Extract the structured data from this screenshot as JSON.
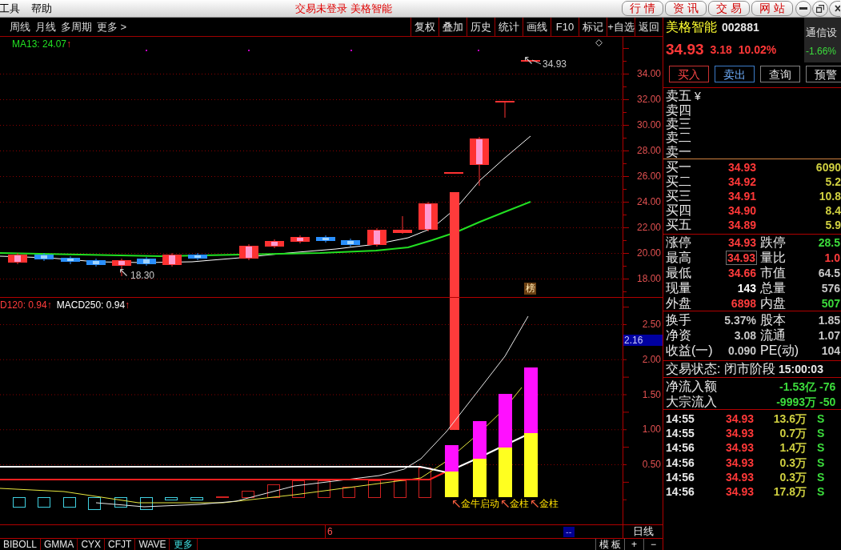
{
  "menu_bar": {
    "menus": [
      "工具",
      "帮助"
    ],
    "status": "交易未登录 美格智能",
    "nav_buttons": [
      "行 情",
      "资 讯",
      "交 易",
      "网 站"
    ]
  },
  "period_bar": {
    "items": [
      "周线",
      "月线",
      "多周期",
      "更多 >"
    ]
  },
  "toolbar": {
    "buttons": [
      "复权",
      "叠加",
      "历史",
      "统计",
      "画线",
      "F10",
      "标记",
      "+自选",
      "返回"
    ]
  },
  "price_chart": {
    "legend": {
      "label": "MA13: 24.07",
      "arrow": "↑"
    },
    "y_axis": [
      "34.00",
      "32.00",
      "30.00",
      "28.00",
      "26.00",
      "24.00",
      "22.00",
      "20.00",
      "18.00"
    ],
    "high_label": "34.93",
    "low_label": "18.30",
    "badge": "榜"
  },
  "indicator_chart": {
    "legend": [
      {
        "label": "D120: 0.94",
        "arrow": "↑",
        "color": "#ff3c3c"
      },
      {
        "label": "MACD250: 0.94",
        "arrow": "↑",
        "color": "#ffffff"
      }
    ],
    "y_axis": [
      "2.50",
      "2.00",
      "1.50",
      "1.00",
      "0.50"
    ],
    "current_value": "2.16",
    "signals": [
      "金牛启动",
      "金柱",
      "金柱"
    ]
  },
  "time_axis": {
    "label": "6",
    "marker": "--",
    "period": "日线"
  },
  "indicator_tabs": [
    "BIBOLL",
    "GMMA",
    "CYX",
    "CFJT",
    "WAVE"
  ],
  "more_tab": "更多",
  "template_controls": [
    "模 板",
    "+",
    "−"
  ],
  "quote_panel": {
    "name": "美格智能",
    "code": "002881",
    "industry": "通信设",
    "industry_change": "-1.66%",
    "price": "34.93",
    "change": "3.18",
    "change_pct": "10.02%",
    "actions": [
      {
        "label": "买入",
        "kind": "buy"
      },
      {
        "label": "卖出",
        "kind": "sell"
      },
      {
        "label": "查询",
        "kind": "plain"
      },
      {
        "label": "预警",
        "kind": "plain"
      }
    ],
    "currency_mark": "¥",
    "ask_levels": [
      "卖五",
      "卖四",
      "卖三",
      "卖二",
      "卖一"
    ],
    "bid_levels": [
      {
        "label": "买一",
        "price": "34.93",
        "volume": "6090"
      },
      {
        "label": "买二",
        "price": "34.92",
        "volume": "5.2"
      },
      {
        "label": "买三",
        "price": "34.91",
        "volume": "10.8"
      },
      {
        "label": "买四",
        "price": "34.90",
        "volume": "8.4"
      },
      {
        "label": "买五",
        "price": "34.89",
        "volume": "5.9"
      }
    ],
    "stats_groups": [
      {
        "rows": [
          [
            {
              "label": "涨停",
              "value": "34.93",
              "color": "#ff3c3c",
              "highlighted": false
            },
            {
              "label": "跌停",
              "value": "28.5",
              "color": "#3cdc3c",
              "highlighted": false
            }
          ],
          [
            {
              "label": "最高",
              "value": "34.93",
              "color": "#ff3c3c",
              "highlighted": true
            },
            {
              "label": "量比",
              "value": "1.0",
              "color": "#ff3c3c",
              "highlighted": false
            }
          ],
          [
            {
              "label": "最低",
              "value": "34.66",
              "color": "#ff3c3c",
              "highlighted": false
            },
            {
              "label": "市值",
              "value": "64.5",
              "color": "#c8c8c8",
              "highlighted": false
            }
          ],
          [
            {
              "label": "现量",
              "value": "143",
              "color": "#ffffff",
              "highlighted": false
            },
            {
              "label": "总量",
              "value": "576",
              "color": "#c8c8c8",
              "highlighted": false
            }
          ],
          [
            {
              "label": "外盘",
              "value": "6898",
              "color": "#ff3c3c",
              "highlighted": false
            },
            {
              "label": "内盘",
              "value": "507",
              "color": "#3cdc3c",
              "highlighted": false
            }
          ]
        ]
      },
      {
        "rows": [
          [
            {
              "label": "换手",
              "value": "5.37%",
              "color": "#c8c8c8",
              "highlighted": false
            },
            {
              "label": "股本",
              "value": "1.85",
              "color": "#c8c8c8",
              "highlighted": false
            }
          ],
          [
            {
              "label": "净资",
              "value": "3.08",
              "color": "#c8c8c8",
              "highlighted": false
            },
            {
              "label": "流通",
              "value": "1.07",
              "color": "#c8c8c8",
              "highlighted": false
            }
          ],
          [
            {
              "label": "收益(一)",
              "value": "0.090",
              "color": "#c8c8c8",
              "highlighted": false
            },
            {
              "label": "PE(动)",
              "value": "104",
              "color": "#c8c8c8",
              "highlighted": false
            }
          ]
        ]
      }
    ],
    "trade_status": {
      "label": "交易状态: 闭市阶段",
      "time": "15:00:03"
    },
    "flows": [
      {
        "label": "净流入额",
        "value": "-1.53亿",
        "extra": "-76"
      },
      {
        "label": "大宗流入",
        "value": "-9993万",
        "extra": "-50"
      }
    ],
    "ticks": [
      {
        "time": "14:55",
        "price": "34.93",
        "volume": "13.6万",
        "side": "S"
      },
      {
        "time": "14:55",
        "price": "34.93",
        "volume": "0.7万",
        "side": "S"
      },
      {
        "time": "14:56",
        "price": "34.93",
        "volume": "1.4万",
        "side": "S"
      },
      {
        "time": "14:56",
        "price": "34.93",
        "volume": "0.3万",
        "side": "S"
      },
      {
        "time": "14:56",
        "price": "34.93",
        "volume": "0.3万",
        "side": "S"
      },
      {
        "time": "14:56",
        "price": "34.93",
        "volume": "17.8万",
        "side": "S"
      }
    ]
  }
}
